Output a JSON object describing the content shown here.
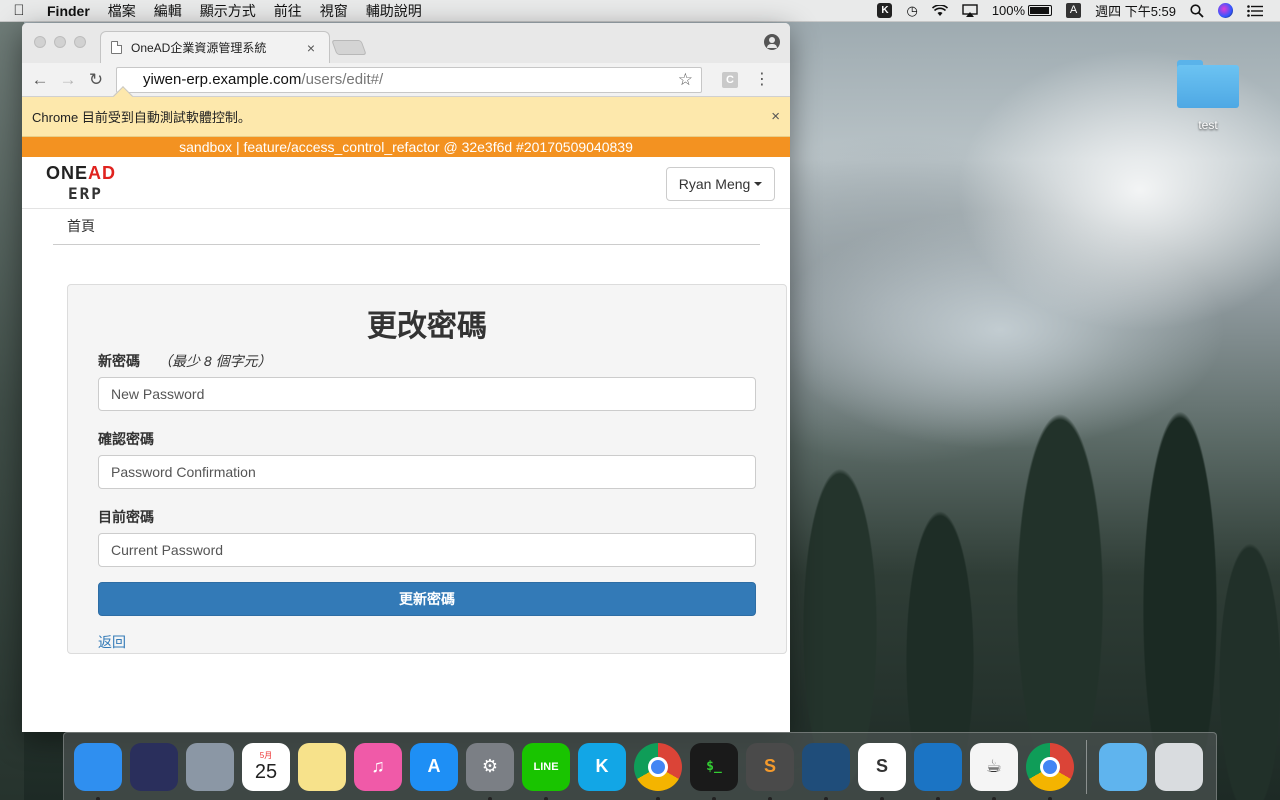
{
  "menubar": {
    "app_name": "Finder",
    "menus": [
      "檔案",
      "編輯",
      "顯示方式",
      "前往",
      "視窗",
      "輔助說明"
    ],
    "status": {
      "battery": "100%",
      "input_method": "A",
      "clock": "週四 下午5:59",
      "icons": [
        "keyboard-icon",
        "time-machine-icon",
        "wifi-icon",
        "airplay-icon",
        "battery-icon",
        "input-source-icon",
        "search-icon",
        "siri-icon",
        "notification-center-icon"
      ]
    }
  },
  "desktop": {
    "folder_label": "test"
  },
  "browser": {
    "tab_title": "OneAD企業資源管理系統",
    "url_host": "yiwen-erp.example.com",
    "url_path": "/users/edit#/",
    "extension_label": "C",
    "infobar_text": "Chrome 目前受到自動測試軟體控制。"
  },
  "page": {
    "env_banner": "sandbox | feature/access_control_refactor @ 32e3f6d #20170509040839",
    "logo_top_a": "ONE",
    "logo_top_b": "AD",
    "logo_sub": "ERP",
    "user_menu": "Ryan Meng",
    "breadcrumb": "首頁",
    "form": {
      "title": "更改密碼",
      "new_password_label": "新密碼",
      "new_password_hint": "（最少 8 個字元）",
      "new_password_placeholder": "New Password",
      "confirm_label": "確認密碼",
      "confirm_placeholder": "Password Confirmation",
      "current_label": "目前密碼",
      "current_placeholder": "Current Password",
      "submit": "更新密碼",
      "back": "返回"
    }
  },
  "dock": {
    "items": [
      {
        "name": "finder",
        "color": "#2f8ff0",
        "running": true
      },
      {
        "name": "siri",
        "color": "#2a2f5c",
        "running": false
      },
      {
        "name": "launchpad",
        "color": "#8b97a5",
        "running": false
      },
      {
        "name": "calendar",
        "color": "#ffffff",
        "glyph": "25",
        "month": "5月",
        "running": false
      },
      {
        "name": "notes",
        "color": "#f7e28b",
        "running": false
      },
      {
        "name": "itunes",
        "color": "#f05aa8",
        "glyph": "♫",
        "running": false
      },
      {
        "name": "app-store",
        "color": "#1e8ff5",
        "glyph": "A",
        "running": false
      },
      {
        "name": "system-preferences",
        "color": "#7b7f85",
        "glyph": "⚙",
        "running": true
      },
      {
        "name": "line",
        "color": "#19c400",
        "glyph": "LINE",
        "running": true
      },
      {
        "name": "kkbox",
        "color": "#12a6e6",
        "glyph": "K",
        "running": false
      },
      {
        "name": "chrome",
        "color": "#ffffff",
        "running": true
      },
      {
        "name": "terminal",
        "color": "#1a1a1a",
        "glyph": "$_",
        "running": true
      },
      {
        "name": "sublime-text",
        "color": "#4a4a4a",
        "glyph": "S",
        "running": true
      },
      {
        "name": "sourcetree",
        "color": "#1f4d7a",
        "running": true
      },
      {
        "name": "slack",
        "color": "#ffffff",
        "glyph": "S",
        "running": true
      },
      {
        "name": "visual-studio-code",
        "color": "#1b74c4",
        "running": true
      },
      {
        "name": "java",
        "color": "#f5f5f5",
        "glyph": "☕",
        "running": true
      },
      {
        "name": "chrome-canary",
        "color": "#ffffff",
        "running": true
      },
      {
        "name": "downloads-folder",
        "color": "#5fb4ee",
        "running": false
      },
      {
        "name": "trash",
        "color": "#d9dcdf",
        "running": false
      }
    ]
  }
}
